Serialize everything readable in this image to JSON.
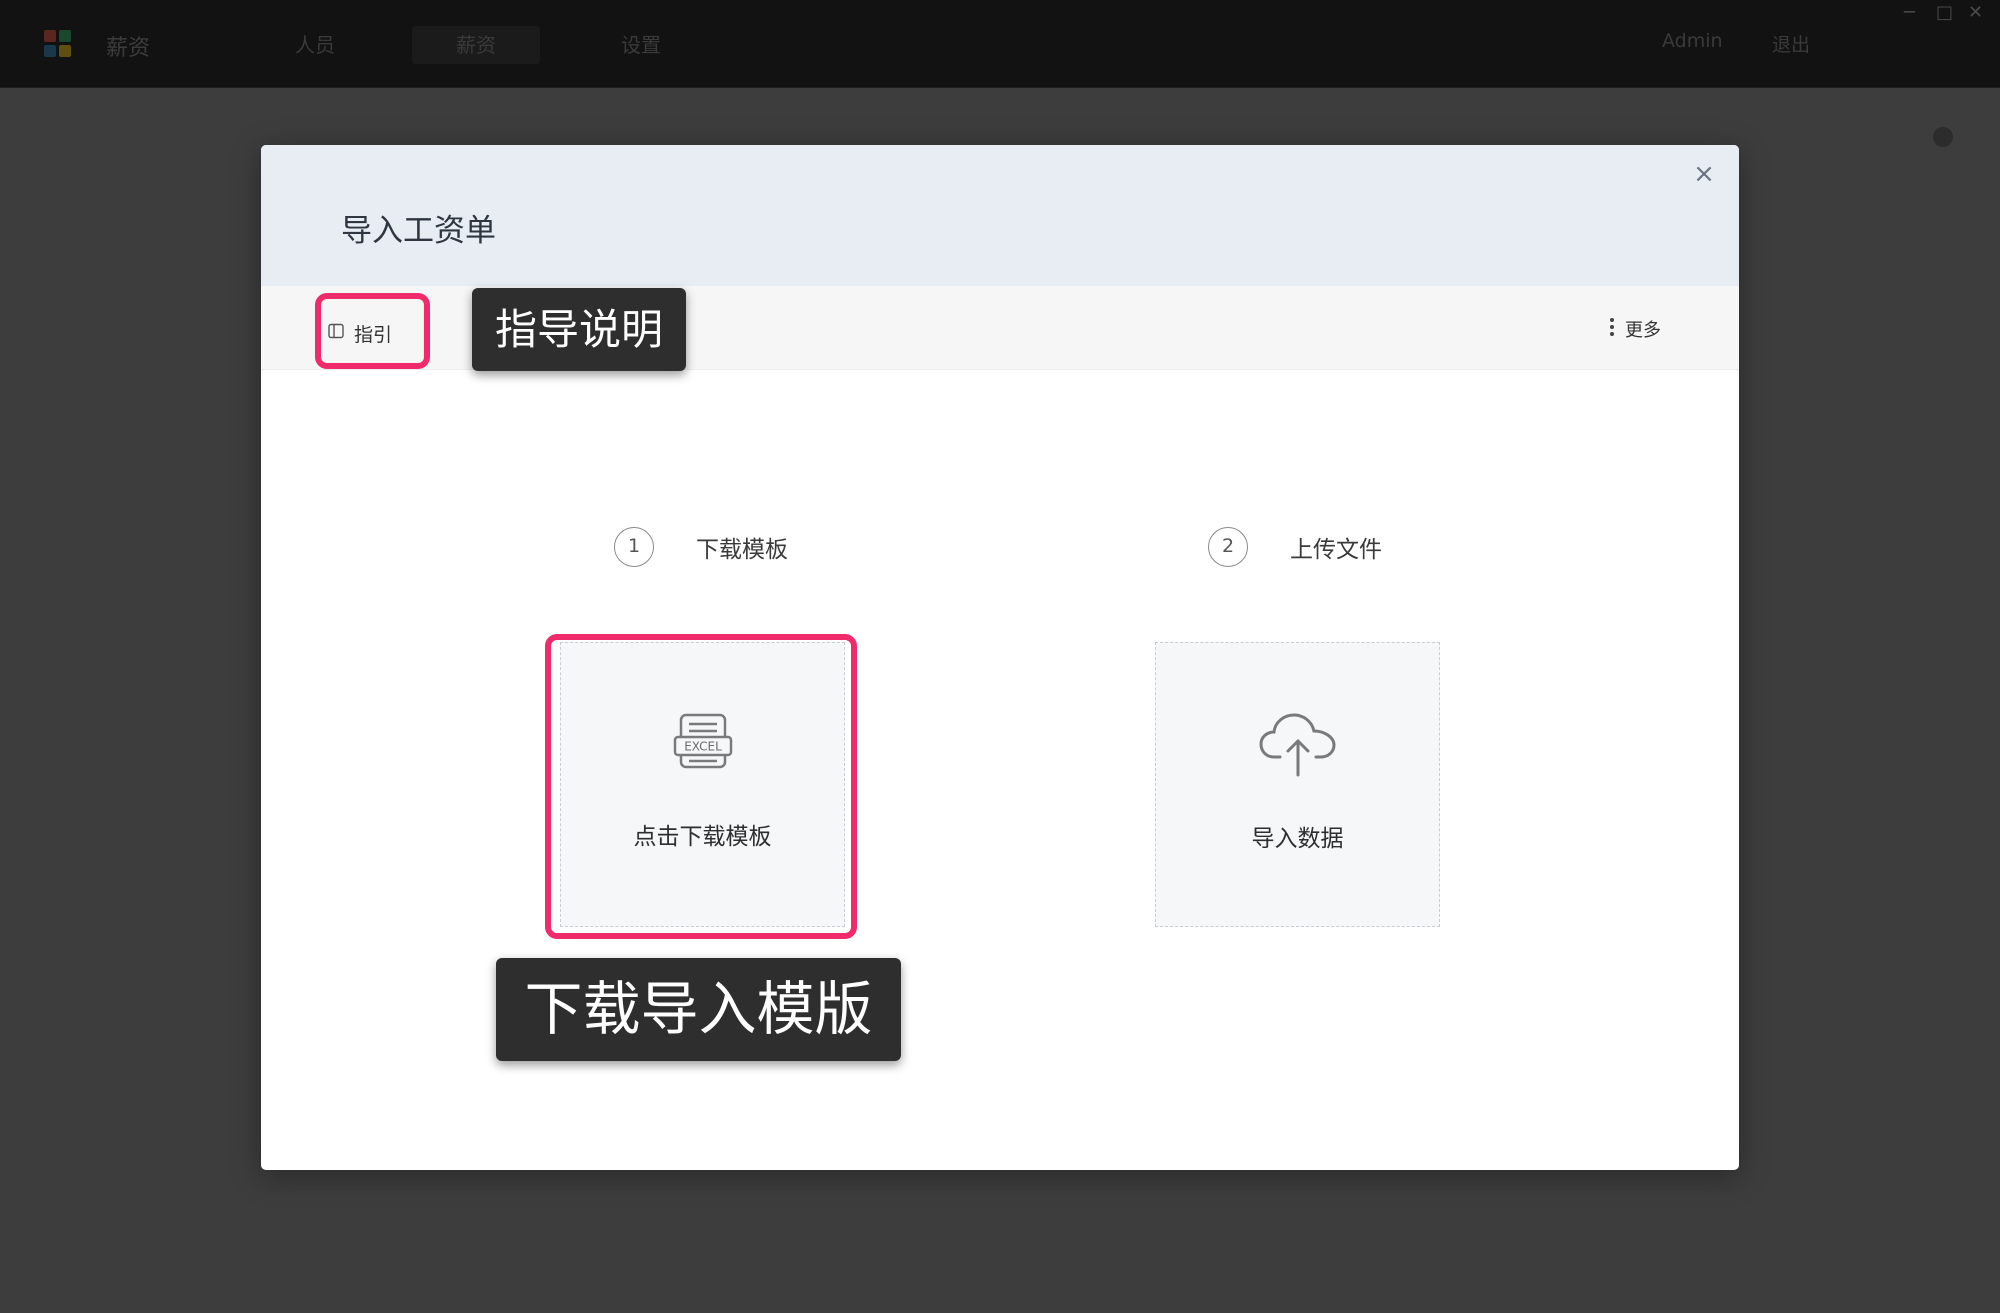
{
  "topbar": {
    "app_name": "薪资",
    "nav": [
      {
        "label": "人员"
      },
      {
        "label": "薪资"
      },
      {
        "label": "设置"
      }
    ],
    "user": "Admin",
    "logout": "退出"
  },
  "modal": {
    "title": "导入工资单",
    "close_label": "×",
    "toolbar": {
      "guide_label": "指引",
      "more_label": "更多"
    },
    "steps": [
      {
        "number": "1",
        "label": "下载模板"
      },
      {
        "number": "2",
        "label": "上传文件"
      }
    ],
    "cards": {
      "download_label": "点击下载模板",
      "excel_icon_text": "EXCEL",
      "import_label": "导入数据"
    }
  },
  "annotations": {
    "guide_callout": "指导说明",
    "download_callout": "下载导入模版"
  },
  "colors": {
    "highlight": "#ef2b6b",
    "callout_bg": "#2e2e2e",
    "header_bg": "#e7edf3"
  }
}
